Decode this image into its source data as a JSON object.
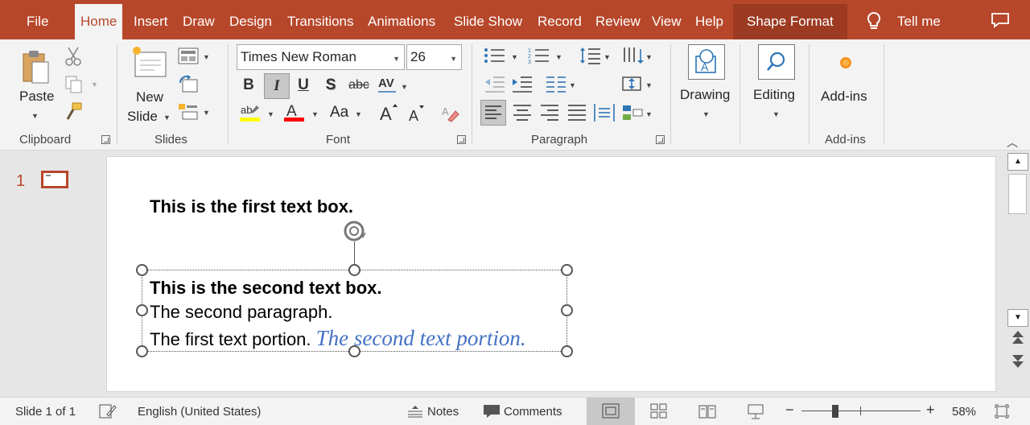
{
  "tabs": {
    "file": "File",
    "home": "Home",
    "insert": "Insert",
    "draw": "Draw",
    "design": "Design",
    "transitions": "Transitions",
    "animations": "Animations",
    "slide_show": "Slide Show",
    "record": "Record",
    "review": "Review",
    "view": "View",
    "help": "Help",
    "shape_format": "Shape Format",
    "tell_me": "Tell me"
  },
  "ribbon": {
    "clipboard": {
      "paste": "Paste",
      "group": "Clipboard"
    },
    "slides": {
      "new_slide_line1": "New",
      "new_slide_line2": "Slide",
      "group": "Slides"
    },
    "font": {
      "font_name": "Times New Roman",
      "font_size": "26",
      "group": "Font",
      "bold": "B",
      "italic": "I",
      "underline": "U",
      "shadow": "S",
      "strike": "abc",
      "change_case": "Aa"
    },
    "paragraph": {
      "group": "Paragraph"
    },
    "drawing": {
      "label": "Drawing"
    },
    "editing": {
      "label": "Editing"
    },
    "addins": {
      "label": "Add-ins",
      "group": "Add-ins"
    }
  },
  "thumbnails": {
    "slide_number": "1"
  },
  "slide": {
    "textbox1": "This is the first text box.",
    "textbox2": {
      "line1": "This is the second text box.",
      "line2": "The second paragraph.",
      "line3_portion1": "The first text portion. ",
      "line3_portion2": "The second text portion."
    }
  },
  "status": {
    "slide_of": "Slide 1 of 1",
    "language": "English (United States)",
    "notes": "Notes",
    "comments": "Comments",
    "zoom": "58%",
    "zoom_level_percent": 58
  },
  "colors": {
    "accent": "#b7472a",
    "italic_text": "#4472c4",
    "font_color_bar": "#ff0000",
    "highlight_bar": "#ffff00",
    "addins_dot": "#f7941d"
  },
  "icons": [
    "lightbulb-icon",
    "comment-icon",
    "paste-icon",
    "cut-icon",
    "copy-icon",
    "format-painter-icon",
    "new-slide-icon",
    "layout-icon",
    "reset-icon",
    "section-icon",
    "bold-icon",
    "italic-icon",
    "underline-icon",
    "shadow-icon",
    "strikethrough-icon",
    "char-spacing-icon",
    "highlight-icon",
    "font-color-icon",
    "change-case-icon",
    "grow-font-icon",
    "shrink-font-icon",
    "clear-format-icon",
    "bullets-icon",
    "numbering-icon",
    "line-spacing-icon",
    "text-direction-icon",
    "decrease-indent-icon",
    "increase-indent-icon",
    "columns-icon",
    "align-text-icon",
    "align-left-icon",
    "align-center-icon",
    "align-right-icon",
    "justify-icon",
    "distribute-icon",
    "smartart-icon",
    "drawing-icon",
    "search-icon",
    "addins-icon",
    "rotate-handle-icon",
    "notes-icon",
    "comments-icon",
    "normal-view-icon",
    "slide-sorter-icon",
    "reading-view-icon",
    "slideshow-icon",
    "fit-slide-icon",
    "spellcheck-icon"
  ]
}
